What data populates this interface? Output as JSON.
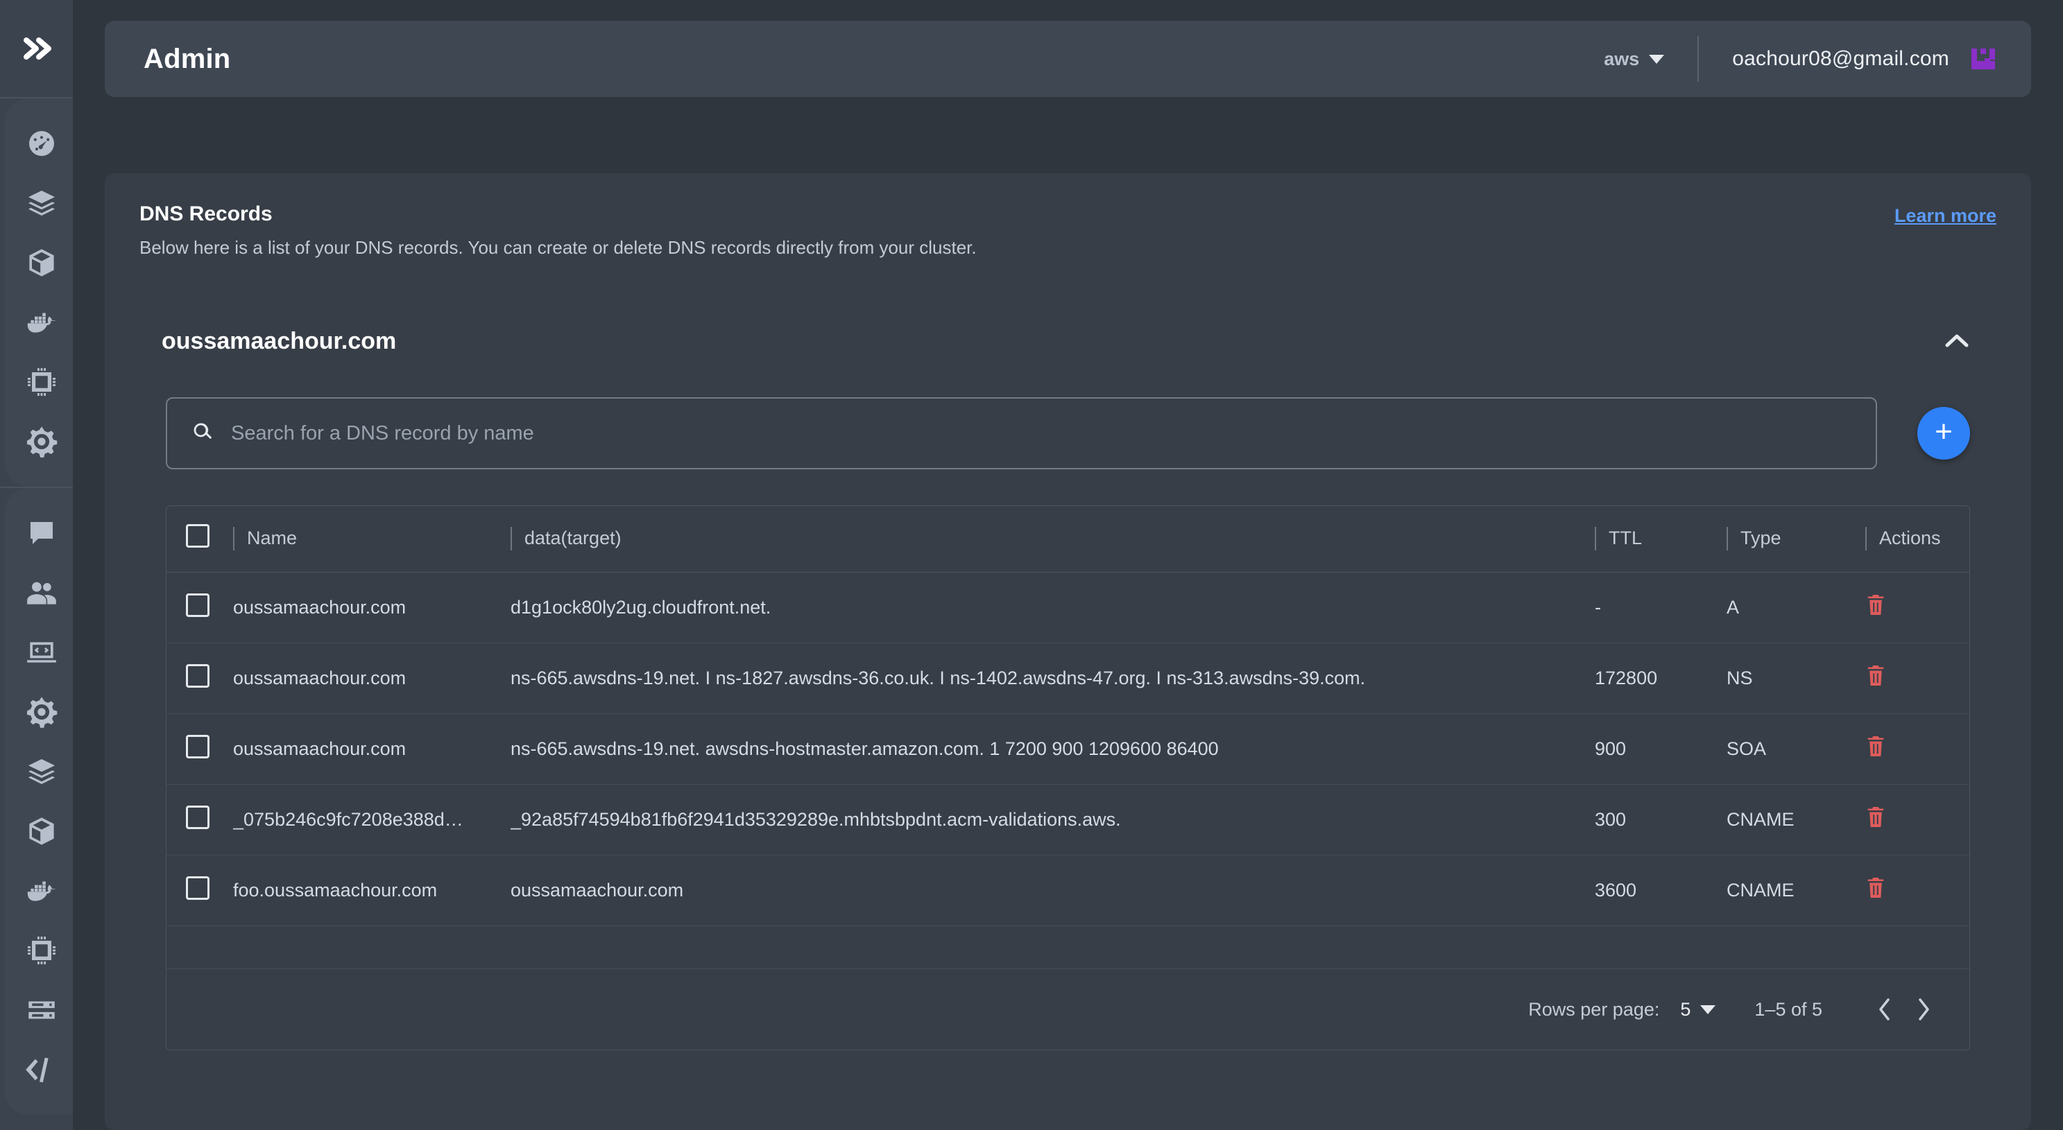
{
  "sidebar": {
    "collapse_toggle": "expand-sidebar",
    "groups": [
      {
        "name": "primary",
        "items": [
          {
            "icon": "gauge-dashboard-icon",
            "label": "Dashboard"
          },
          {
            "icon": "layers-stack-icon",
            "label": "Stacks"
          },
          {
            "icon": "cube-box-icon",
            "label": "Containers"
          },
          {
            "icon": "docker-whale-icon",
            "label": "Docker"
          },
          {
            "icon": "cpu-chip-icon",
            "label": "Compute"
          },
          {
            "icon": "kubernetes-helm-icon",
            "label": "Kubernetes"
          }
        ]
      },
      {
        "name": "secondary",
        "items": [
          {
            "icon": "chat-bubble-icon",
            "label": "Messages"
          },
          {
            "icon": "users-group-icon",
            "label": "Users"
          },
          {
            "icon": "laptop-code-icon",
            "label": "Code"
          },
          {
            "icon": "kubernetes-helm-icon",
            "label": "Kubernetes"
          },
          {
            "icon": "layers-stack-icon",
            "label": "Stacks"
          },
          {
            "icon": "cube-box-icon",
            "label": "Containers"
          },
          {
            "icon": "docker-whale-icon",
            "label": "Docker"
          },
          {
            "icon": "cpu-chip-icon",
            "label": "Compute"
          },
          {
            "icon": "server-rack-icon",
            "label": "Servers"
          },
          {
            "icon": "code-brackets-icon",
            "label": "API"
          }
        ]
      }
    ]
  },
  "topbar": {
    "title": "Admin",
    "cloud_provider": "aws",
    "user_email": "oachour08@gmail.com",
    "avatar_color": "#8b2fc9"
  },
  "card": {
    "title": "DNS Records",
    "subtitle": "Below here is a list of your DNS records. You can create or delete DNS records directly from your cluster.",
    "learn_more": "Learn more",
    "learn_more_color": "#5b9bf8"
  },
  "accordion": {
    "domain": "oussamaachour.com",
    "expanded": true
  },
  "search": {
    "placeholder": "Search for a DNS record by name",
    "value": "",
    "add_label": "+",
    "add_color": "#2f81f7"
  },
  "table": {
    "columns": [
      "Name",
      "data(target)",
      "TTL",
      "Type",
      "Actions"
    ],
    "rows": [
      {
        "name": "oussamaachour.com",
        "data": "d1g1ock80ly2ug.cloudfront.net.",
        "ttl": "-",
        "type": "A",
        "action": "delete-icon"
      },
      {
        "name": "oussamaachour.com",
        "data": "ns-665.awsdns-19.net. I ns-1827.awsdns-36.co.uk. I ns-1402.awsdns-47.org. I ns-313.awsdns-39.com.",
        "ttl": "172800",
        "type": "NS",
        "action": "delete-icon"
      },
      {
        "name": "oussamaachour.com",
        "data": "ns-665.awsdns-19.net. awsdns-hostmaster.amazon.com. 1 7200 900 1209600 86400",
        "ttl": "900",
        "type": "SOA",
        "action": "delete-icon"
      },
      {
        "name": "_075b246c9fc7208e388d…",
        "data": "_92a85f74594b81fb6f2941d35329289e.mhbtsbpdnt.acm-validations.aws.",
        "ttl": "300",
        "type": "CNAME",
        "action": "delete-icon"
      },
      {
        "name": "foo.oussamaachour.com",
        "data": "oussamaachour.com",
        "ttl": "3600",
        "type": "CNAME",
        "action": "delete-icon"
      }
    ]
  },
  "pagination": {
    "rows_per_page_label": "Rows per page:",
    "rows_per_page_value": "5",
    "range": "1–5 of 5",
    "prev": "prev-page",
    "next": "next-page"
  }
}
